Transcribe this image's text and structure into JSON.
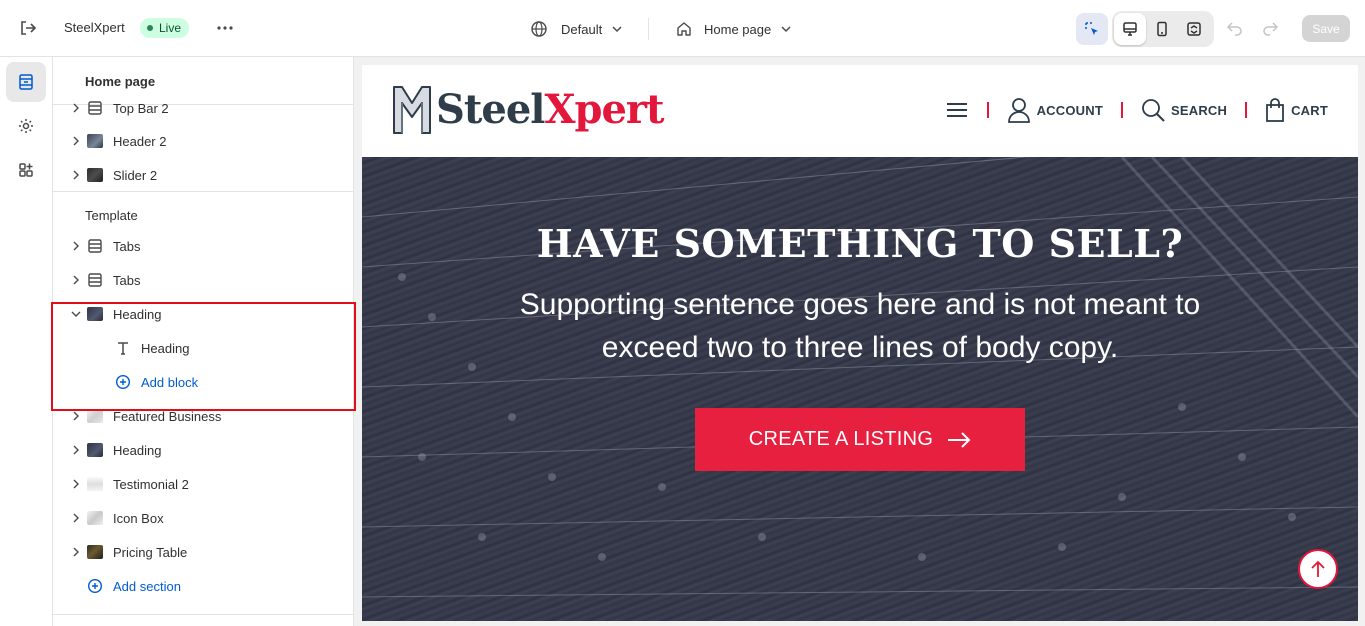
{
  "topbar": {
    "store_name": "SteelXpert",
    "status": "Live",
    "theme": "Default",
    "page": "Home page",
    "save_label": "Save",
    "icons": [
      "exit-icon",
      "more-icon",
      "globe-icon",
      "home-icon",
      "chevron-down-icon",
      "inspector-icon",
      "desktop-icon",
      "mobile-icon",
      "fullwidth-icon",
      "undo-icon",
      "redo-icon"
    ]
  },
  "rail": {
    "items": [
      "sections-icon",
      "settings-icon",
      "apps-icon"
    ]
  },
  "sidebar": {
    "title": "Home page",
    "header_items": [
      {
        "label": "Top Bar 2"
      },
      {
        "label": "Header 2"
      },
      {
        "label": "Slider 2"
      }
    ],
    "template_label": "Template",
    "template_items": [
      {
        "label": "Tabs"
      },
      {
        "label": "Tabs"
      },
      {
        "label": "Heading"
      },
      {
        "label": "Heading"
      },
      {
        "label": "Add block"
      },
      {
        "label": "Featured Business"
      },
      {
        "label": "Heading"
      },
      {
        "label": "Testimonial 2"
      },
      {
        "label": "Icon Box"
      },
      {
        "label": "Pricing Table"
      },
      {
        "label": "Add section"
      }
    ]
  },
  "preview": {
    "logo": {
      "part1": "Steel",
      "part2": "Xpert"
    },
    "nav": {
      "account": "ACCOUNT",
      "search": "SEARCH",
      "cart": "CART"
    },
    "hero": {
      "title": "HAVE SOMETHING TO SELL?",
      "subtitle": "Supporting sentence goes here and is not meant to exceed two to three lines of body copy.",
      "cta": "CREATE A LISTING"
    },
    "colors": {
      "brand_dark": "#2e3d49",
      "brand_red": "#e3173c",
      "cta": "#e8203f"
    }
  }
}
